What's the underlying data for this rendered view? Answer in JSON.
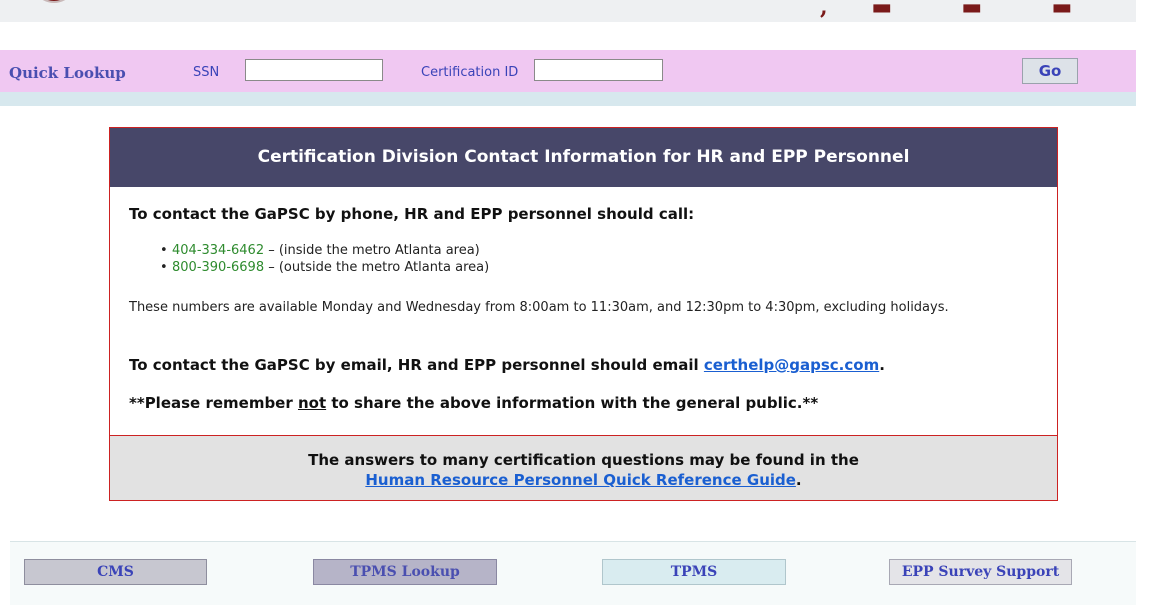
{
  "quick_lookup": {
    "title": "Quick Lookup",
    "ssn_label": "SSN",
    "ssn_value": "",
    "cert_label": "Certification ID",
    "cert_value": "",
    "go_label": "Go"
  },
  "contact": {
    "header": "Certification Division Contact Information for HR and EPP Personnel",
    "phone_heading": "To contact the GaPSC by phone, HR and EPP personnel should call:",
    "phones": [
      {
        "number": "404-334-6462",
        "note": " – (inside the metro Atlanta area)"
      },
      {
        "number": "800-390-6698",
        "note": " – (outside the metro Atlanta area)"
      }
    ],
    "hours": "These numbers are available Monday and Wednesday from 8:00am to 11:30am, and 12:30pm to 4:30pm, excluding holidays.",
    "email_prefix": "To contact the GaPSC by email, HR and EPP personnel should email ",
    "email": "certhelp@gapsc.com",
    "email_suffix": ".",
    "reminder_prefix": "**Please remember ",
    "reminder_not": "not",
    "reminder_suffix": " to share the above information with the general public.**",
    "footer_line1": "The answers to many certification questions may be found in the",
    "guide_link": "Human Resource Personnel Quick Reference Guide",
    "footer_suffix": "."
  },
  "bottom_nav": {
    "cms": "CMS",
    "tpms_lookup": "TPMS Lookup",
    "tpms": "TPMS",
    "epp_survey": "EPP Survey Support"
  },
  "colors": {
    "lookup_bar": "#f0c8f2",
    "panel_header": "#474769",
    "panel_border": "#cc2222",
    "phone_green": "#2e8b2e",
    "link_blue": "#1a5fd1"
  }
}
